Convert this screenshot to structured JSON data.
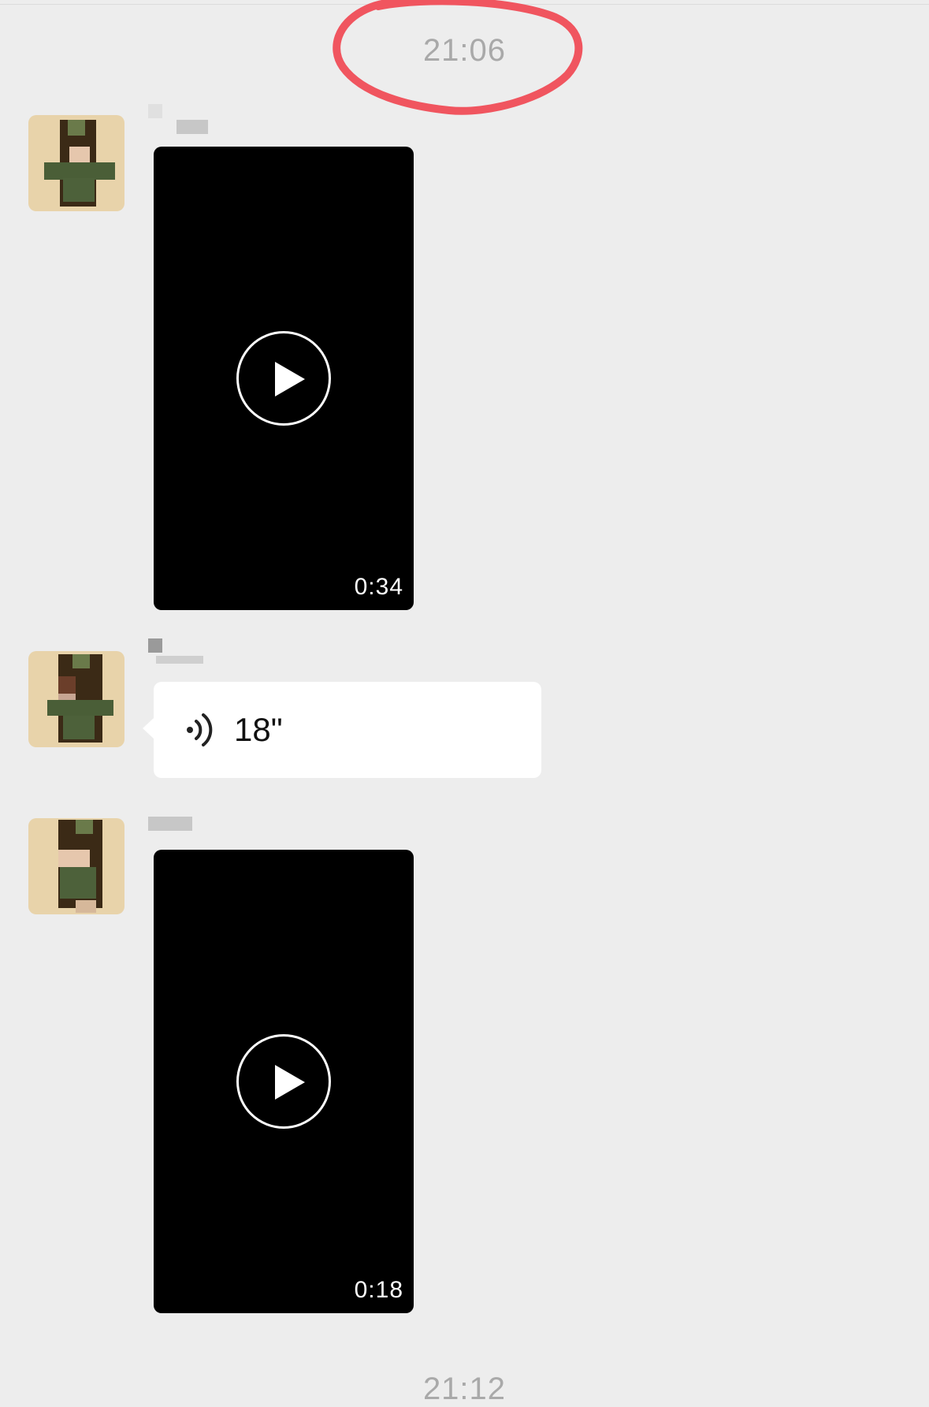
{
  "chat": {
    "timestamps": [
      "21:06",
      "21:12"
    ],
    "messages": [
      {
        "type": "video",
        "duration": "0:34"
      },
      {
        "type": "voice",
        "length": "18\""
      },
      {
        "type": "video",
        "duration": "0:18"
      }
    ]
  },
  "colors": {
    "background": "#ededed",
    "timestamp": "#a9a9a9",
    "annotation": "#f0555f",
    "avatar_bg": "#e8d3aa"
  },
  "icons": [
    "play-icon",
    "voice-wave-icon"
  ]
}
